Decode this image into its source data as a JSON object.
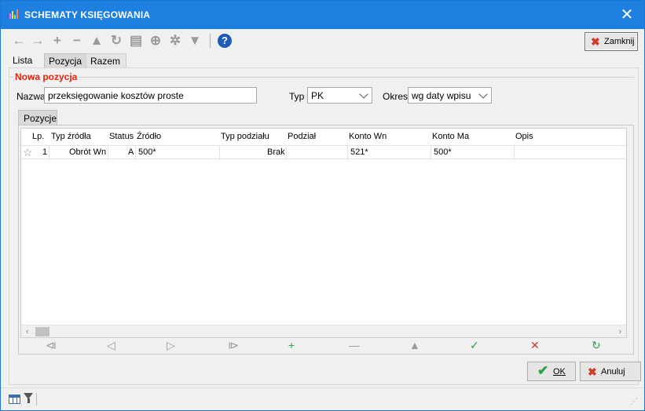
{
  "window": {
    "title": "SCHEMATY KSIĘGOWANIA",
    "close_glyph": "✕"
  },
  "toolbar": {
    "icons": [
      "arrow-left-icon",
      "arrow-right-icon",
      "plus-icon",
      "minus-icon",
      "triangle-icon",
      "refresh-icon",
      "print-icon",
      "search-zoom-icon",
      "settings-icon",
      "filter-icon"
    ],
    "close_button_label": "Zamknij"
  },
  "tabs": [
    "Lista",
    "Pozycja",
    "Razem"
  ],
  "form": {
    "group_title": "Nowa pozycja",
    "nazwa_label": "Nazwa",
    "nazwa_value": "przeksięgowanie kosztów proste",
    "typ_label": "Typ",
    "typ_value": "PK",
    "okres_label": "Okres",
    "okres_value": "wg daty wpisu"
  },
  "subtab": "Pozycje",
  "grid": {
    "columns": [
      "Lp.",
      "Typ źródła",
      "Status",
      "Źródło",
      "Typ podziału",
      "Podział",
      "Konto Wn",
      "Konto Ma",
      "Opis"
    ],
    "rows": [
      {
        "lp": "1",
        "typ_zrodla": "Obrót Wn",
        "status": "A",
        "zrodlo": "500*",
        "typ_podzialu": "Brak",
        "podzial": "",
        "konto_wn": "521*",
        "konto_ma": "500*",
        "opis": ""
      }
    ]
  },
  "footer": {
    "ok_label": "OK",
    "cancel_label": "Anuluj"
  },
  "colors": {
    "titlebar": "#1d7fe0",
    "accent_red": "#e8200c",
    "ok_green": "#2aa24a"
  }
}
